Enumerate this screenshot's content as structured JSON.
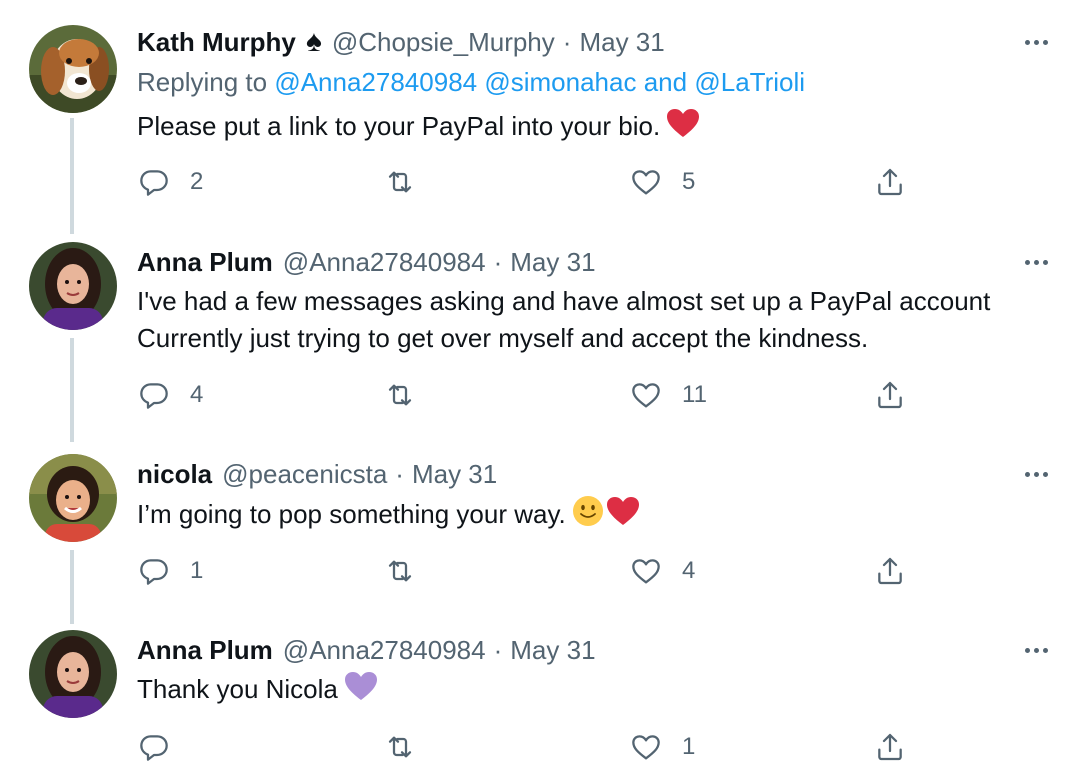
{
  "tweets": [
    {
      "name": "Kath Murphy",
      "badge": "♠",
      "handle": "@Chopsie_Murphy",
      "separator": "·",
      "date": "May 31",
      "replying_prefix": "Replying to",
      "replying_1": "@Anna27840984",
      "replying_2": "@simonahac",
      "replying_and": "and",
      "replying_3": "@LaTrioli",
      "text_line1": "Please put a link to your PayPal into your bio.",
      "replies": "2",
      "retweets": "",
      "likes": "5"
    },
    {
      "name": "Anna Plum",
      "handle": "@Anna27840984",
      "separator": "·",
      "date": "May 31",
      "text_line1": "I've had a few messages asking and have almost set up a PayPal account",
      "text_line2": "Currently just trying to get over myself and accept the kindness.",
      "replies": "4",
      "retweets": "",
      "likes": "11"
    },
    {
      "name": "nicola",
      "handle": "@peacenicsta",
      "separator": "·",
      "date": "May 31",
      "text_line1": "I’m going to pop something your way.",
      "replies": "1",
      "retweets": "",
      "likes": "4"
    },
    {
      "name": "Anna Plum",
      "handle": "@Anna27840984",
      "separator": "·",
      "date": "May 31",
      "text_line1": "Thank you Nicola",
      "replies": "",
      "retweets": "",
      "likes": "1"
    }
  ],
  "colors": {
    "text": "#0f1419",
    "secondary": "#536471",
    "link": "#1d9bf0",
    "thread_line": "#cfd9de",
    "heart_red": "#dd2e44",
    "heart_purple": "#aa8ed6"
  }
}
